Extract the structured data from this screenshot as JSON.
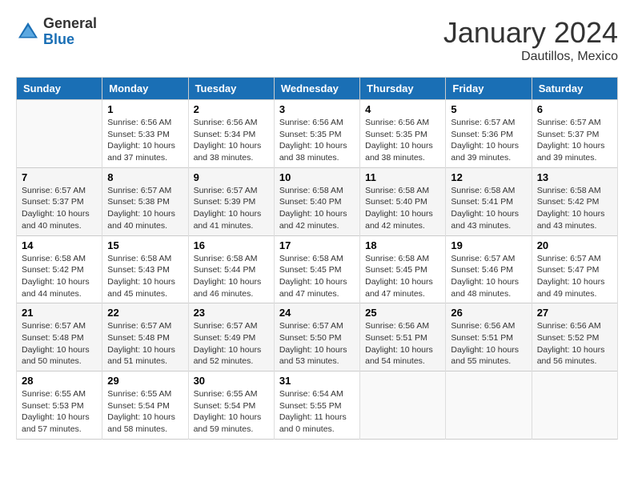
{
  "header": {
    "logo_general": "General",
    "logo_blue": "Blue",
    "month_year": "January 2024",
    "location": "Dautillos, Mexico"
  },
  "days_of_week": [
    "Sunday",
    "Monday",
    "Tuesday",
    "Wednesday",
    "Thursday",
    "Friday",
    "Saturday"
  ],
  "weeks": [
    [
      {
        "day": "",
        "sunrise": "",
        "sunset": "",
        "daylight": ""
      },
      {
        "day": "1",
        "sunrise": "6:56 AM",
        "sunset": "5:33 PM",
        "daylight": "10 hours and 37 minutes."
      },
      {
        "day": "2",
        "sunrise": "6:56 AM",
        "sunset": "5:34 PM",
        "daylight": "10 hours and 38 minutes."
      },
      {
        "day": "3",
        "sunrise": "6:56 AM",
        "sunset": "5:35 PM",
        "daylight": "10 hours and 38 minutes."
      },
      {
        "day": "4",
        "sunrise": "6:56 AM",
        "sunset": "5:35 PM",
        "daylight": "10 hours and 38 minutes."
      },
      {
        "day": "5",
        "sunrise": "6:57 AM",
        "sunset": "5:36 PM",
        "daylight": "10 hours and 39 minutes."
      },
      {
        "day": "6",
        "sunrise": "6:57 AM",
        "sunset": "5:37 PM",
        "daylight": "10 hours and 39 minutes."
      }
    ],
    [
      {
        "day": "7",
        "sunrise": "6:57 AM",
        "sunset": "5:37 PM",
        "daylight": "10 hours and 40 minutes."
      },
      {
        "day": "8",
        "sunrise": "6:57 AM",
        "sunset": "5:38 PM",
        "daylight": "10 hours and 40 minutes."
      },
      {
        "day": "9",
        "sunrise": "6:57 AM",
        "sunset": "5:39 PM",
        "daylight": "10 hours and 41 minutes."
      },
      {
        "day": "10",
        "sunrise": "6:58 AM",
        "sunset": "5:40 PM",
        "daylight": "10 hours and 42 minutes."
      },
      {
        "day": "11",
        "sunrise": "6:58 AM",
        "sunset": "5:40 PM",
        "daylight": "10 hours and 42 minutes."
      },
      {
        "day": "12",
        "sunrise": "6:58 AM",
        "sunset": "5:41 PM",
        "daylight": "10 hours and 43 minutes."
      },
      {
        "day": "13",
        "sunrise": "6:58 AM",
        "sunset": "5:42 PM",
        "daylight": "10 hours and 43 minutes."
      }
    ],
    [
      {
        "day": "14",
        "sunrise": "6:58 AM",
        "sunset": "5:42 PM",
        "daylight": "10 hours and 44 minutes."
      },
      {
        "day": "15",
        "sunrise": "6:58 AM",
        "sunset": "5:43 PM",
        "daylight": "10 hours and 45 minutes."
      },
      {
        "day": "16",
        "sunrise": "6:58 AM",
        "sunset": "5:44 PM",
        "daylight": "10 hours and 46 minutes."
      },
      {
        "day": "17",
        "sunrise": "6:58 AM",
        "sunset": "5:45 PM",
        "daylight": "10 hours and 47 minutes."
      },
      {
        "day": "18",
        "sunrise": "6:58 AM",
        "sunset": "5:45 PM",
        "daylight": "10 hours and 47 minutes."
      },
      {
        "day": "19",
        "sunrise": "6:57 AM",
        "sunset": "5:46 PM",
        "daylight": "10 hours and 48 minutes."
      },
      {
        "day": "20",
        "sunrise": "6:57 AM",
        "sunset": "5:47 PM",
        "daylight": "10 hours and 49 minutes."
      }
    ],
    [
      {
        "day": "21",
        "sunrise": "6:57 AM",
        "sunset": "5:48 PM",
        "daylight": "10 hours and 50 minutes."
      },
      {
        "day": "22",
        "sunrise": "6:57 AM",
        "sunset": "5:48 PM",
        "daylight": "10 hours and 51 minutes."
      },
      {
        "day": "23",
        "sunrise": "6:57 AM",
        "sunset": "5:49 PM",
        "daylight": "10 hours and 52 minutes."
      },
      {
        "day": "24",
        "sunrise": "6:57 AM",
        "sunset": "5:50 PM",
        "daylight": "10 hours and 53 minutes."
      },
      {
        "day": "25",
        "sunrise": "6:56 AM",
        "sunset": "5:51 PM",
        "daylight": "10 hours and 54 minutes."
      },
      {
        "day": "26",
        "sunrise": "6:56 AM",
        "sunset": "5:51 PM",
        "daylight": "10 hours and 55 minutes."
      },
      {
        "day": "27",
        "sunrise": "6:56 AM",
        "sunset": "5:52 PM",
        "daylight": "10 hours and 56 minutes."
      }
    ],
    [
      {
        "day": "28",
        "sunrise": "6:55 AM",
        "sunset": "5:53 PM",
        "daylight": "10 hours and 57 minutes."
      },
      {
        "day": "29",
        "sunrise": "6:55 AM",
        "sunset": "5:54 PM",
        "daylight": "10 hours and 58 minutes."
      },
      {
        "day": "30",
        "sunrise": "6:55 AM",
        "sunset": "5:54 PM",
        "daylight": "10 hours and 59 minutes."
      },
      {
        "day": "31",
        "sunrise": "6:54 AM",
        "sunset": "5:55 PM",
        "daylight": "11 hours and 0 minutes."
      },
      {
        "day": "",
        "sunrise": "",
        "sunset": "",
        "daylight": ""
      },
      {
        "day": "",
        "sunrise": "",
        "sunset": "",
        "daylight": ""
      },
      {
        "day": "",
        "sunrise": "",
        "sunset": "",
        "daylight": ""
      }
    ]
  ]
}
